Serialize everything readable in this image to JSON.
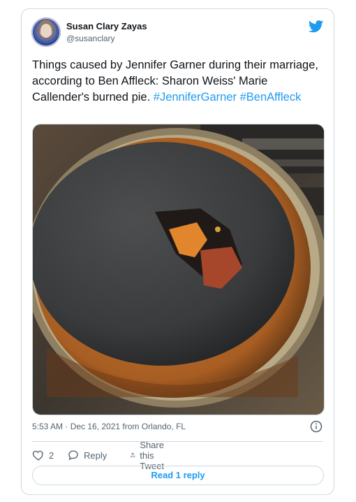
{
  "author": {
    "name": "Susan Clary Zayas",
    "handle": "@susanclary"
  },
  "tweet": {
    "text_plain": "Things caused by Jennifer Garner during their marriage, according to Ben Affleck: Sharon Weiss' Marie Callender's burned pie.",
    "hashtags": [
      "#JenniferGarner",
      "#BenAffleck"
    ],
    "image_description_icon": "burned-pie-photo"
  },
  "meta": {
    "timestamp": "5:53 AM · Dec 16, 2021 from Orlando, FL"
  },
  "actions": {
    "like_count": "2",
    "reply_label": "Reply",
    "share_label": "Share this Tweet"
  },
  "footer": {
    "read_reply_label": "Read 1 reply"
  },
  "colors": {
    "accent": "#1d9bf0",
    "text": "#0f1419",
    "muted": "#536471",
    "border": "#cfd9de"
  }
}
